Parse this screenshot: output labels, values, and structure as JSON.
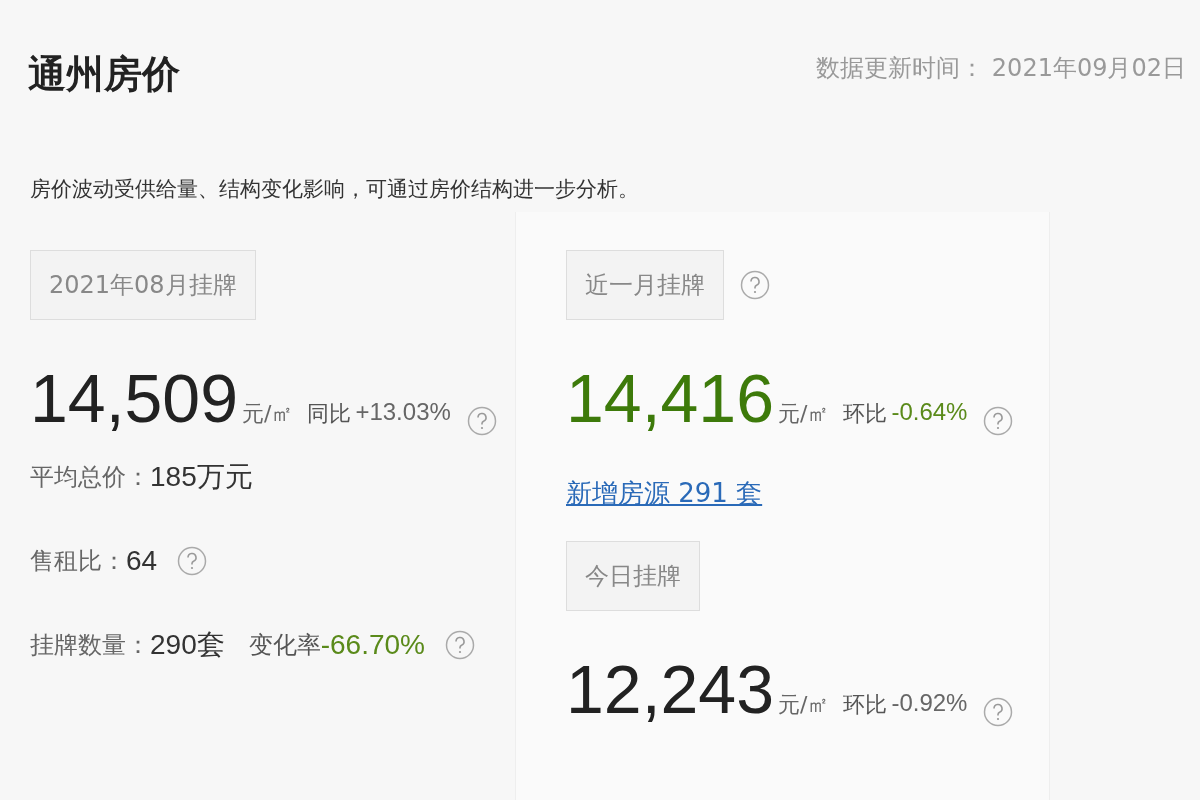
{
  "title": "通州房价",
  "update": {
    "label": "数据更新时间：",
    "value": "2021年09月02日"
  },
  "note": "房价波动受供给量、结构变化影响，可通过房价结构进一步分析。",
  "left": {
    "tag": "2021年08月挂牌",
    "tag_help": false,
    "price": {
      "value": "14,509",
      "unit": "元/㎡",
      "change_label": "同比",
      "change": "+13.03%",
      "value_highlighted": false,
      "change_highlighted": false,
      "help": true
    },
    "stats": [
      {
        "label": "平均总价：",
        "value": "185万元",
        "help": false
      },
      {
        "label": "售租比：",
        "value": "64",
        "help": true
      },
      {
        "label": "挂牌数量：",
        "value": "290套",
        "extra_label": "变化率",
        "extra_value": "-66.70%",
        "extra_highlighted": true,
        "help": true
      }
    ]
  },
  "right": [
    {
      "tag": "近一月挂牌",
      "tag_help": true,
      "price": {
        "value": "14,416",
        "unit": "元/㎡",
        "change_label": "环比",
        "change": "-0.64%",
        "value_highlighted": true,
        "change_highlighted": true,
        "help": true
      },
      "link": "新增房源 291 套"
    },
    {
      "tag": "今日挂牌",
      "tag_help": false,
      "price": {
        "value": "12,243",
        "unit": "元/㎡",
        "change_label": "环比",
        "change": "-0.92%",
        "value_highlighted": false,
        "change_highlighted": false,
        "help": true
      }
    }
  ]
}
